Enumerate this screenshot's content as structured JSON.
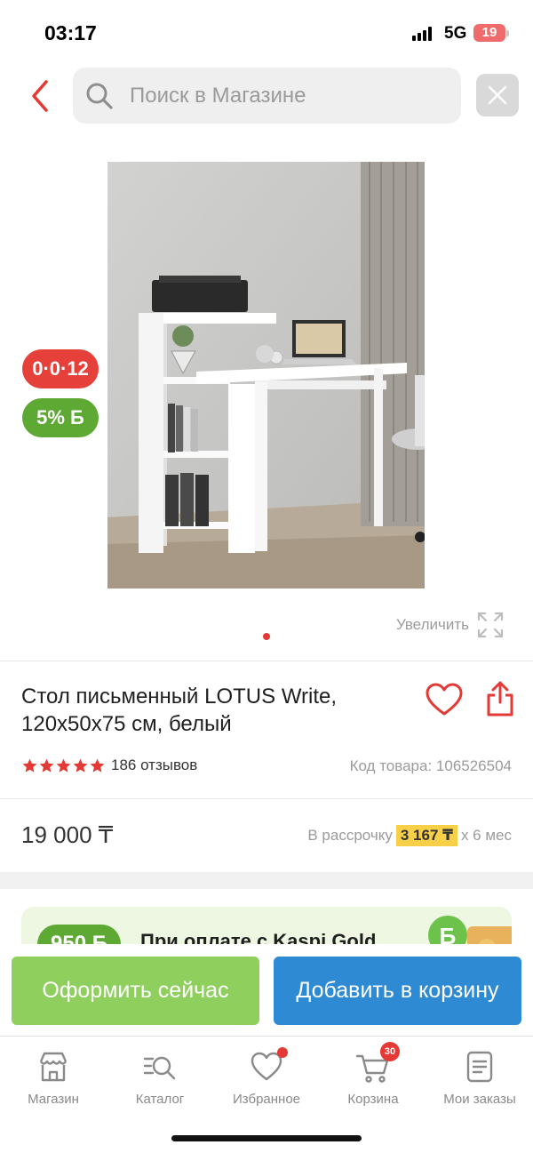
{
  "status_bar": {
    "time": "03:17",
    "network": "5G",
    "battery": "19"
  },
  "search": {
    "placeholder": "Поиск в Магазине",
    "value": ""
  },
  "product": {
    "image_badges": {
      "installment": "0·0·12",
      "bonus": "5% Б"
    },
    "zoom_label": "Увеличить",
    "title": "Стол письменный LOTUS Write, 120х50х75 см, белый",
    "rating": 5,
    "reviews": "186 отзывов",
    "sku": "Код товара: 106526504",
    "price": "19 000 ₸",
    "installment": {
      "prefix": "В рассрочку",
      "amount": "3 167 ₸",
      "suffix": "х 6 мес"
    }
  },
  "promo": {
    "bonus": "950 Б",
    "text": "При оплате с Kaspi Gold"
  },
  "actions": {
    "checkout": "Оформить сейчас",
    "add_to_cart": "Добавить в корзину"
  },
  "tabs": [
    {
      "label": "Магазин",
      "icon": "shop-icon"
    },
    {
      "label": "Каталог",
      "icon": "catalog-search-icon"
    },
    {
      "label": "Избранное",
      "icon": "heart-icon"
    },
    {
      "label": "Корзина",
      "icon": "cart-icon",
      "badge": "30"
    },
    {
      "label": "Мои заказы",
      "icon": "orders-icon"
    }
  ],
  "colors": {
    "accent_red": "#e53935",
    "green": "#5ea933",
    "blue": "#2f8ad4",
    "highlight": "#f8d048"
  }
}
